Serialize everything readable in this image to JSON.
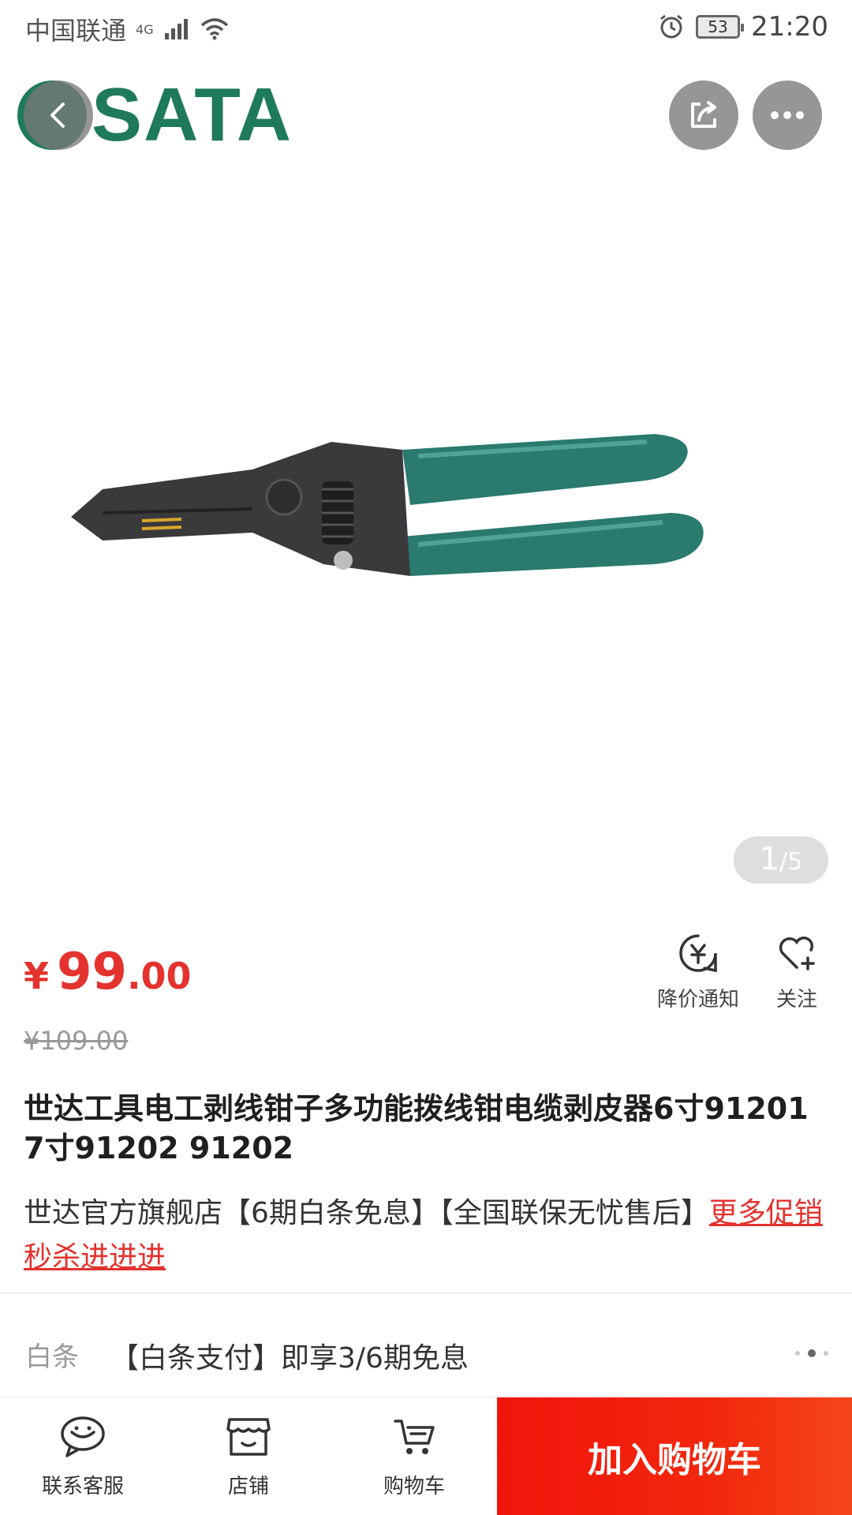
{
  "status_bar": {
    "carrier": "中国联通",
    "network": "4G",
    "battery": "53",
    "time": "21:20"
  },
  "brand": {
    "logo_text": "SATA"
  },
  "gallery": {
    "current": "1",
    "separator": "/",
    "total": "5"
  },
  "price": {
    "symbol": "¥",
    "integer": "99",
    "decimal": ".00",
    "original": "¥109.00"
  },
  "actions": {
    "price_notify": "降价通知",
    "follow": "关注"
  },
  "product": {
    "title": "世达工具电工剥线钳子多功能拨线钳电缆剥皮器6寸91201 7寸91202 91202",
    "promo_text": "世达官方旗舰店【6期白条免息】【全国联保无忧售后】",
    "promo_link": "更多促销秒杀进进进"
  },
  "baitiao": {
    "label": "白条",
    "text": "【白条支付】即享3/6期免息"
  },
  "bottom_bar": {
    "service": "联系客服",
    "shop": "店铺",
    "cart": "购物车",
    "add_to_cart": "加入购物车"
  },
  "colors": {
    "price_red": "#e4322e",
    "brand_green": "#1f7a5b",
    "cta_red": "#f2270c",
    "handle_teal": "#2a7a6e"
  },
  "icons": {
    "back": "chevron-left-icon",
    "share": "share-icon",
    "more": "more-dots-icon",
    "notify": "price-drop-bell-icon",
    "follow": "heart-plus-icon",
    "service": "chat-face-icon",
    "shop": "store-icon",
    "cart": "cart-icon"
  }
}
